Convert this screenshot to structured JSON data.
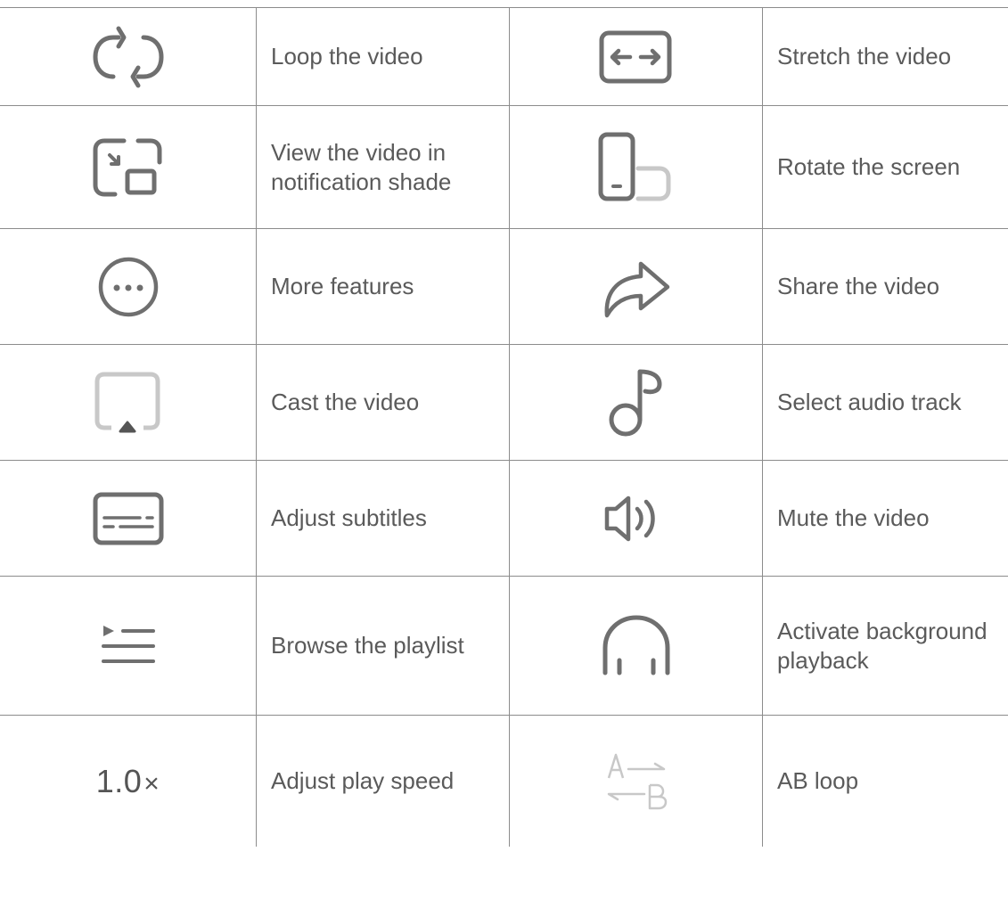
{
  "rows": [
    {
      "left": {
        "icon": "loop-icon",
        "label": "Loop the video"
      },
      "right": {
        "icon": "stretch-icon",
        "label": "Stretch the video"
      }
    },
    {
      "left": {
        "icon": "picture-in-picture-icon",
        "label": "View the video in\nnotification shade"
      },
      "right": {
        "icon": "rotate-screen-icon",
        "label": "Rotate the screen"
      }
    },
    {
      "left": {
        "icon": "more-icon",
        "label": "More features"
      },
      "right": {
        "icon": "share-icon",
        "label": "Share the video"
      }
    },
    {
      "left": {
        "icon": "cast-icon",
        "label": "Cast the video"
      },
      "right": {
        "icon": "music-note-icon",
        "label": "Select audio track"
      }
    },
    {
      "left": {
        "icon": "subtitles-icon",
        "label": "Adjust subtitles"
      },
      "right": {
        "icon": "speaker-icon",
        "label": "Mute the video"
      }
    },
    {
      "left": {
        "icon": "playlist-icon",
        "label": "Browse the playlist"
      },
      "right": {
        "icon": "headphones-icon",
        "label": "Activate background\nplayback"
      }
    },
    {
      "left": {
        "icon": "play-speed-icon",
        "icon_text": "1.0",
        "icon_suffix": "×",
        "label": "Adjust play speed"
      },
      "right": {
        "icon": "ab-loop-icon",
        "label": "AB loop"
      }
    }
  ],
  "colors": {
    "icon": "#6f6f6f",
    "icon_light": "#c8c8c8",
    "text": "#5a5a5a",
    "border": "#8c8c8c"
  }
}
